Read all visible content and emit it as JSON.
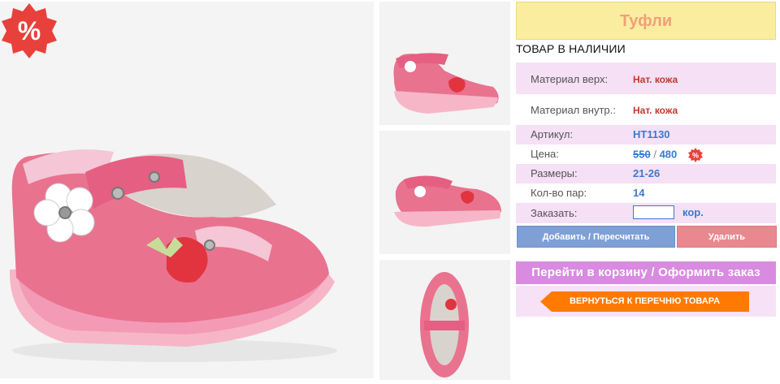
{
  "product": {
    "title": "Туфли",
    "stock_status": "ТОВАР В НАЛИЧИИ",
    "sale_badge": "%",
    "specs": [
      {
        "label": "Материал верх:",
        "value": "Нат. кожа"
      },
      {
        "label": "Материал внутр.:",
        "value": "Нат. кожа"
      },
      {
        "label": "Артикул:",
        "value": "HT1130"
      }
    ],
    "price_label": "Цена:",
    "old_price": "550",
    "price_sep": "/",
    "new_price": "480",
    "mini_badge": "%",
    "sizes_label": "Размеры:",
    "sizes_value": "21-26",
    "pairs_label": "Кол-во пар:",
    "pairs_value": "14",
    "order_label": "Заказать:",
    "order_value": "",
    "order_unit": "кор."
  },
  "actions": {
    "add_label": "Добавить / Пересчитать",
    "delete_label": "Удалить",
    "cart_label": "Перейти в корзину / Оформить заказ",
    "back_label": "ВЕРНУТЬСЯ К ПЕРЕЧНЮ ТОВАРА"
  },
  "colors": {
    "title_bg": "#fbeda0",
    "title_text": "#f0a07a",
    "row_pink": "#f5e0f5",
    "add_button": "#7fa0d6",
    "delete_button": "#e9898f",
    "cart_button": "#d88be0",
    "back_button": "#ff7a00",
    "sale_red": "#e8413c"
  }
}
